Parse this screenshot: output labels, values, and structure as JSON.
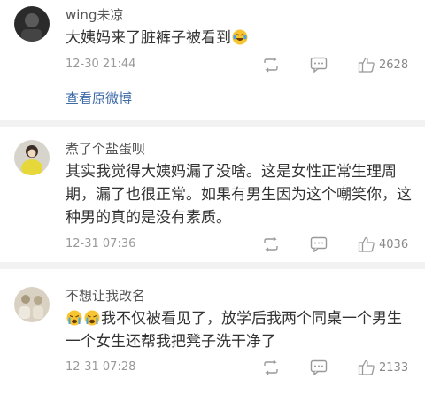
{
  "comments": [
    {
      "username": "wing未凉",
      "text": "大姨妈来了脏裤子被看到",
      "emoji_after": "laugh-cry-emoji",
      "time": "12-30 21:44",
      "likes": "2628",
      "link": "查看原微博"
    },
    {
      "username": "煮了个盐蛋呗",
      "text": "其实我觉得大姨妈漏了没啥。这是女性正常生理周期，漏了也很正常。如果有男生因为这个嘲笑你，这种男的真的是没有素质。",
      "time": "12-31 07:36",
      "likes": "4036"
    },
    {
      "username": "不想让我改名",
      "emoji_before": [
        "cry-emoji",
        "cry-emoji"
      ],
      "text": "我不仅被看见了，放学后我两个同桌一个男生一个女生还帮我把凳子洗干净了",
      "time": "12-31 07:28",
      "likes": "2133"
    }
  ],
  "icons": {
    "repost": "repost-icon",
    "comment": "comment-icon",
    "like": "thumbs-up-icon"
  },
  "colors": {
    "link": "#3e6aa8",
    "divider": "#f2f2f2",
    "meta": "#999999"
  }
}
